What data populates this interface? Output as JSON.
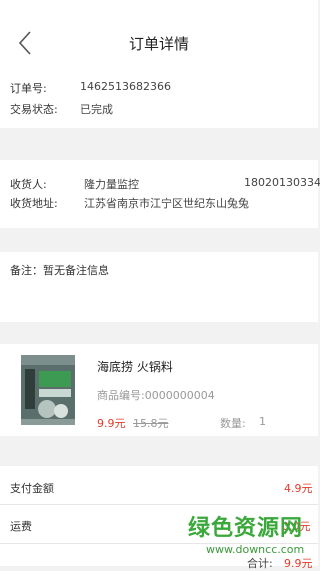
{
  "header": {
    "title": "订单详情"
  },
  "order": {
    "number_label": "订单号:",
    "number": "1462513682366",
    "status_label": "交易状态:",
    "status": "已完成"
  },
  "shipping": {
    "receiver_label": "收货人:",
    "receiver": "隆力量监控",
    "phone": "18020130334",
    "address_label": "收货地址:",
    "address": "江苏省南京市江宁区世纪东山兔兔"
  },
  "remark": {
    "text": "备注：暂无备注信息"
  },
  "product": {
    "name": "海底捞 火锅料",
    "code": "商品编号:0000000004",
    "price": "9.9元",
    "original_price": "15.8元",
    "quantity_label": "数量:",
    "quantity": "1",
    "image_label": "海底捞"
  },
  "payment": {
    "paid_label": "支付金额",
    "paid": "4.9元",
    "shipping_label": "运费",
    "shipping": "0.0元",
    "total_label": "合计:",
    "total": "9.9元"
  },
  "watermark": {
    "text": "绿色资源网",
    "url": "www.downcc.com"
  },
  "colors": {
    "accent": "#e23a2a",
    "background": "#f2f2f2"
  }
}
